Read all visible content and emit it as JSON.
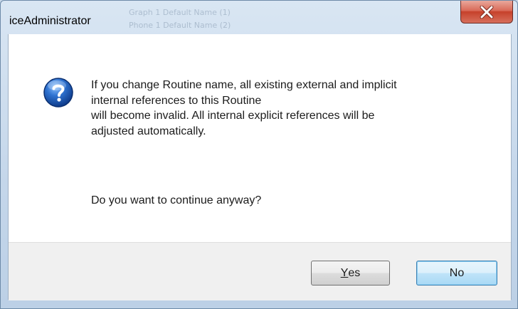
{
  "window": {
    "title": "iceAdministrator",
    "background_ghost_text": [
      "Graph  1 Default Name (1)",
      "Phone  1 Default Name (2)"
    ]
  },
  "dialog": {
    "icon": "question-icon",
    "message_lines": [
      "If you change Routine name, all existing external and implicit",
      "internal references to this Routine",
      "will become invalid. All internal explicit references will be",
      "adjusted automatically."
    ],
    "question": "Do you want to continue anyway?"
  },
  "buttons": {
    "yes_mnemonic": "Y",
    "yes_rest": "es",
    "no_label": "No"
  },
  "colors": {
    "accent_default_button": "#3c7fb1",
    "close_button": "#c6412b",
    "icon_blue": "#1c5fb5"
  }
}
